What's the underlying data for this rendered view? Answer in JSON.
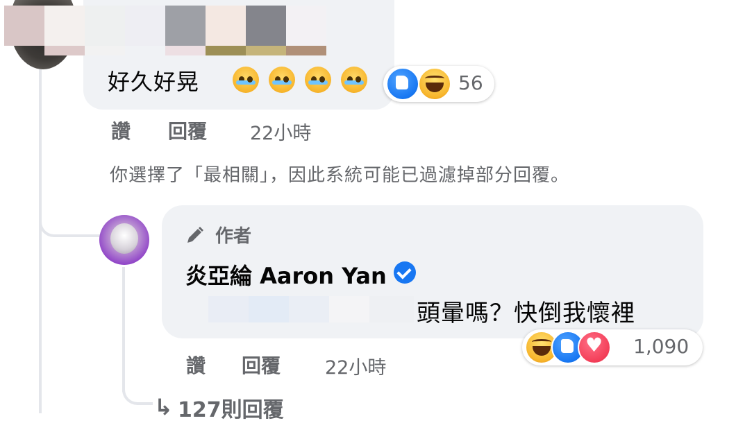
{
  "comment": {
    "text": "好久好晃",
    "reaction_count": "56",
    "actions": {
      "like": "讚",
      "reply": "回覆"
    },
    "time": "22小時",
    "filter_notice": "你選擇了「最相關」，因此系統可能已過濾掉部分回覆。"
  },
  "reply": {
    "badge": "作者",
    "author": "炎亞綸 Aaron Yan",
    "text": "頭暈嗎？快倒我懷裡",
    "reaction_count": "1,090",
    "actions": {
      "like": "讚",
      "reply": "回覆"
    },
    "time": "22小時"
  },
  "view_replies": "127則回覆",
  "icons": {
    "reply_badge": "pencil-icon",
    "verified": "verified-badge-icon",
    "reactions_1": [
      "like-icon",
      "haha-icon"
    ],
    "reactions_2": [
      "haha-icon",
      "like-icon",
      "love-icon"
    ],
    "emoji": "crying-face-emoji",
    "more_replies": "reply-arrow-icon"
  },
  "colors": {
    "bubble": "#f0f2f5",
    "secondary_text": "#65676b",
    "verified": "#1877f2",
    "like": "#1877f2",
    "love": "#f33e58",
    "haha": "#f7b52c"
  }
}
